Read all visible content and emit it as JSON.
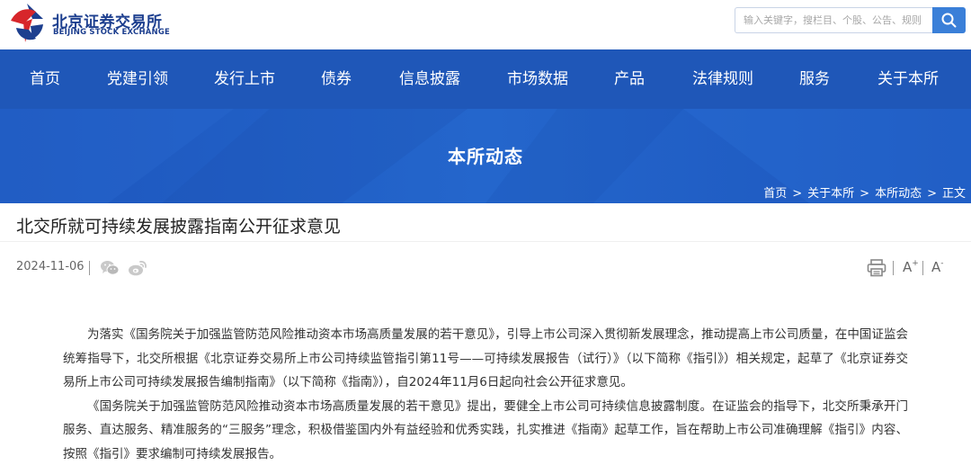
{
  "header": {
    "logo_cn": "北京证券交易所",
    "logo_en": "BEIJING STOCK EXCHANGE",
    "search_placeholder": "输入关键字，搜栏目、个股、公告、规则"
  },
  "nav": {
    "items": [
      "首页",
      "党建引领",
      "发行上市",
      "债券",
      "信息披露",
      "市场数据",
      "产品",
      "法律规则",
      "服务",
      "关于本所"
    ]
  },
  "banner": {
    "title": "本所动态",
    "breadcrumbs": [
      "首页",
      "关于本所",
      "本所动态",
      "正文"
    ],
    "separator": ">"
  },
  "article": {
    "title": "北交所就可持续发展披露指南公开征求意见",
    "date": "2024-11-06",
    "font_plus": "A",
    "font_plus_sup": "+",
    "font_minus": "A",
    "font_minus_sup": "-",
    "paragraphs": [
      "为落实《国务院关于加强监管防范风险推动资本市场高质量发展的若干意见》，引导上市公司深入贯彻新发展理念，推动提高上市公司质量，在中国证监会统筹指导下，北交所根据《北京证券交易所上市公司持续监管指引第11号——可持续发展报告（试行）》（以下简称《指引》）相关规定，起草了《北京证券交易所上市公司可持续发展报告编制指南》（以下简称《指南》），自2024年11月6日起向社会公开征求意见。",
      "《国务院关于加强监管防范风险推动资本市场高质量发展的若干意见》提出，要健全上市公司可持续信息披露制度。在证监会的指导下，北交所秉承开门服务、直达服务、精准服务的“三服务”理念，积极借鉴国内外有益经验和优秀实践，扎实推进《指南》起草工作，旨在帮助上市公司准确理解《指引》内容、按照《指引》要求编制可持续发展报告。"
    ]
  },
  "colors": {
    "brand_blue": "#1f57b8",
    "logo_red": "#d7262b",
    "search_button": "#3a7fd8"
  },
  "icons": [
    "logo-mark-icon",
    "search-icon",
    "wechat-icon",
    "weibo-icon",
    "print-icon"
  ]
}
